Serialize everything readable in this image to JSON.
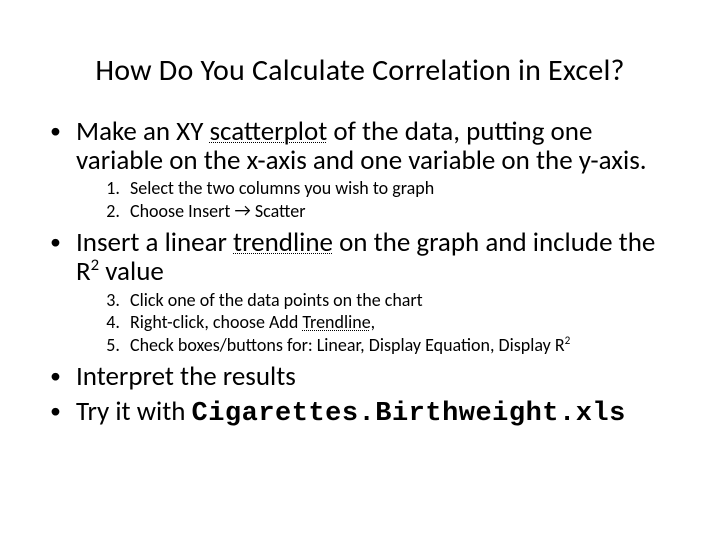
{
  "title": "How Do You Calculate Correlation in Excel?",
  "b1": {
    "pre": "Make an XY ",
    "uword": "scatterplot",
    "post": " of the data, putting one variable on the x-axis and one variable on the y-axis."
  },
  "s1": "Select the two columns you wish to graph",
  "s2_pre": "Choose Insert ",
  "s2_arrow": "→",
  "s2_post": " Scatter",
  "b2": {
    "pre": "Insert a linear ",
    "uword": "trendline",
    "mid": " on the graph and include the R",
    "sup": "2",
    "post": " value"
  },
  "s3": "Click one of the data points on the chart",
  "s4_pre": "Right-click, choose Add ",
  "s4_uword": "Trendline",
  "s4_post": ",",
  "s5_pre": "Check boxes/buttons for:  Linear,  Display Equation, Display R",
  "s5_sup": "2",
  "b3": "Interpret the results",
  "b4_pre": "Try it with ",
  "b4_code": "Cigarettes.Birthweight.xls"
}
